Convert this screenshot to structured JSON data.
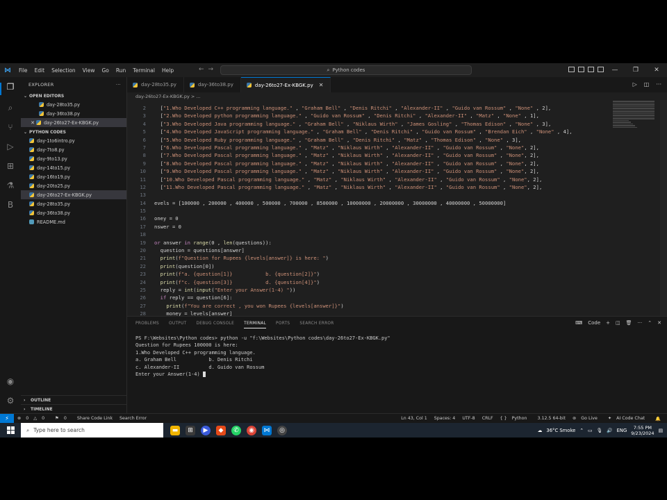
{
  "titlebar": {
    "menu": [
      "File",
      "Edit",
      "Selection",
      "View",
      "Go",
      "Run",
      "Terminal",
      "Help"
    ],
    "search_text": "Python codes"
  },
  "explorer": {
    "title": "EXPLORER",
    "open_editors_label": "OPEN EDITORS",
    "open_editors": [
      "day-28to35.py",
      "day-36to38.py",
      "day-26to27-Ex-KBGK.py"
    ],
    "folder_label": "PYTHON CODES",
    "files": [
      "day-1to6intro.py",
      "day-7to8.py",
      "day-9to13.py",
      "day-14to15.py",
      "day-16to19.py",
      "day-20to25.py",
      "day-26to27-Ex-KBGK.py",
      "day-28to35.py",
      "day-36to38.py",
      "README.md"
    ],
    "outline_label": "OUTLINE",
    "timeline_label": "TIMELINE"
  },
  "tabs": [
    "day-28to35.py",
    "day-36to38.py",
    "day-26to27-Ex-KBGK.py"
  ],
  "breadcrumb": "day-26to27-Ex-KBGK.py > ...",
  "editor": {
    "line_numbers": [
      "2",
      "3",
      "4",
      "5",
      "6",
      "7",
      "8",
      "9",
      "10",
      "11",
      "12",
      "13",
      "14",
      "15",
      "16",
      "17",
      "18",
      "19",
      "20",
      "21",
      "22",
      "23",
      "24",
      "25",
      "26",
      "27",
      "28"
    ],
    "lines": [
      "  [\"1.Who Developed C++ programming language.\" , \"Graham Bell\" , \"Denis Ritchi\" , \"Alexander-II\" , \"Guido van Rossum\" , \"None\" , 2],",
      "  [\"2.Who Developed python programming language.\" , \"Guido van Rossum\" , \"Denis Ritchi\" , \"Alexander-II\" , \"Matz\" , \"None\" , 1],",
      "  [\"3.Who Developed Java programming language.\" , \"Graham Bell\" , \"Niklaus Wirth\" , \"James Gosling\" , \"Thomas Edison\" , \"None\" , 3],",
      "  [\"4.Who Developed JavaScript programming language.\" , \"Graham Bell\" , \"Denis Ritchi\" , \"Guido van Rossum\" , \"Brendan Eich\" , \"None\" , 4],",
      "  [\"5.Who Developed Ruby programming language.\" , \"Graham Bell\" , \"Denis Ritchi\" , \"Matz\" , \"Thomas Edison\" , \"None\" , 3],",
      "  [\"6.Who Developed Pascal programming language.\" , \"Matz\" , \"Niklaus Wirth\" , \"Alexander-II\" , \"Guido van Rossum\" , \"None\", 2],",
      "  [\"7.Who Developed Pascal programming language.\" , \"Matz\" , \"Niklaus Wirth\" , \"Alexander-II\" , \"Guido van Rossum\" , \"None\", 2],",
      "  [\"8.Who Developed Pascal programming language.\" , \"Matz\" , \"Niklaus Wirth\" , \"Alexander-II\" , \"Guido van Rossum\" , \"None\", 2],",
      "  [\"9.Who Developed Pascal programming language.\" , \"Matz\" , \"Niklaus Wirth\" , \"Alexander-II\" , \"Guido van Rossum\" , \"None\", 2],",
      "  [\"10.Who Developed Pascal programming language.\" , \"Matz\" , \"Niklaus Wirth\" , \"Alexander-II\" , \"Guido van Rossum\" , \"None\", 2],",
      "  [\"11.Who Developed Pascal programming language.\" , \"Matz\" , \"Niklaus Wirth\" , \"Alexander-II\" , \"Guido van Rossum\" , \"None\", 2],",
      "",
      "evels = [100000 , 200000 , 400000 , 500000 , 700000 , 8500000 , 10000000 , 20000000 , 30000000 , 40000000 , 50000000]",
      "",
      "oney = 0",
      "nswer = 0",
      "",
      "or answer in range(0 , len(questions)):",
      "  question = questions[answer]",
      "  print(f\"Question for Rupees {levels[answer]} is here: \")",
      "  print(question[0])",
      "  print(f\"a. {question[1]}           b. {question[2]}\")",
      "  print(f\"c. {question[3]}           d. {question[4]}\")",
      "  reply = int(input(\"Enter your Answer(1-4) \"))",
      "  if reply == question[6]:",
      "    print(f\"You are correct , you won Rupees {levels[answer]}\")",
      "    money = levels[answer]"
    ]
  },
  "panel": {
    "tabs": [
      "PROBLEMS",
      "OUTPUT",
      "DEBUG CONSOLE",
      "TERMINAL",
      "PORTS",
      "SEARCH ERROR"
    ],
    "active_tab": "TERMINAL",
    "shell_label": "Code",
    "terminal": [
      "PS F:\\Websites\\Python codes> python -u \"f:\\Websites\\Python codes\\day-26to27-Ex-KBGK.py\"",
      "Question for Rupees 100000 is here:",
      "1.Who Developed C++ programming language.",
      "a. Graham Bell           b. Denis Ritchi",
      "c. Alexander-II          d. Guido van Rossum",
      "Enter your Answer(1-4) "
    ]
  },
  "statusbar": {
    "errors": "0",
    "warnings": "0",
    "info": "0",
    "share": "Share Code Link",
    "search_error": "Search Error",
    "position": "Ln 43, Col 1",
    "spaces": "Spaces: 4",
    "encoding": "UTF-8",
    "eol": "CRLF",
    "language": "Python",
    "version": "3.12.5 64-bit",
    "golive": "Go Live",
    "aichat": "AI Code Chat"
  },
  "taskbar": {
    "search_placeholder": "Type here to search",
    "weather": "36°C  Smoke",
    "lang": "ENG",
    "time": "7:55 PM",
    "date": "9/23/2024"
  },
  "colors": {
    "accent": "#0078d4",
    "editor_bg": "#1f1f1f",
    "sidebar_bg": "#181818"
  }
}
